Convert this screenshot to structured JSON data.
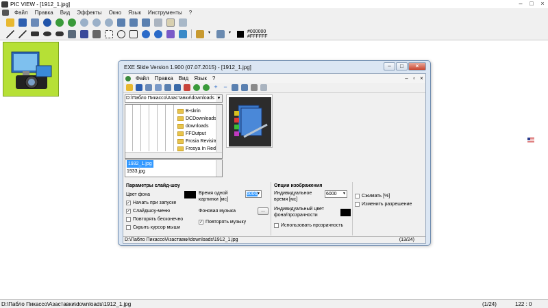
{
  "window": {
    "title": "PIC VIEW - [1912_1.jpg]",
    "controls": [
      "–",
      "□",
      "×"
    ]
  },
  "menubar": [
    "Файл",
    "Правка",
    "Вид",
    "Эффекты",
    "Окно",
    "Язык",
    "Инструменты",
    "?"
  ],
  "toolbar_colors": {
    "fg": "#000000",
    "bg": "#FFFFFF"
  },
  "status": {
    "path": "D:\\Пабло Пикассо\\Азаставки\\downloads\\1912_1.jpg",
    "position": "(1/24)",
    "coords": "122 : 0"
  },
  "dialog": {
    "title": "EXE Slide Version 1.900 (07.07.2015) - [1912_1.jpg]",
    "menu": [
      "Файл",
      "Правка",
      "Вид",
      "Язык",
      "?"
    ],
    "path": "D:\\Пабло Пикассо\\Азаставки\\downloads",
    "folders": [
      "B-skrin",
      "DCDownloads",
      "downloads",
      "FFOutput",
      "Frosia Revisited",
      "Frosya In Red"
    ],
    "files": [
      "1932_1.jpg",
      "1933.jpg"
    ],
    "params": {
      "heading": "Параметры слайд-шоу",
      "bg_color_label": "Цвет фона",
      "start_on_launch": "Начать при запуске",
      "slideshow_menu": "Слайдшоу-меню",
      "repeat_forever": "Повторять бесконечно",
      "hide_cursor": "Скрыть курсор мыши",
      "time_label": "Время одной картинки [мс]",
      "time_value": "6000",
      "music_label": "Фоновая музыка",
      "music_btn": "...",
      "repeat_music": "Повторять музыку"
    },
    "image_opts": {
      "heading": "Опции изображения",
      "ind_time": "Индивидуальное время [мс]",
      "ind_time_value": "6000",
      "ind_color": "Индивидуальный цвет фона/прозрачности",
      "use_transparency": "Использовать прозрачность",
      "compress": "Сжимать [%]",
      "resize": "Изменить разрешение"
    },
    "status": {
      "path": "D:\\Пабло Пикассо\\Азаставки\\downloads\\1912_1.jpg",
      "count": "(13/24)"
    }
  }
}
